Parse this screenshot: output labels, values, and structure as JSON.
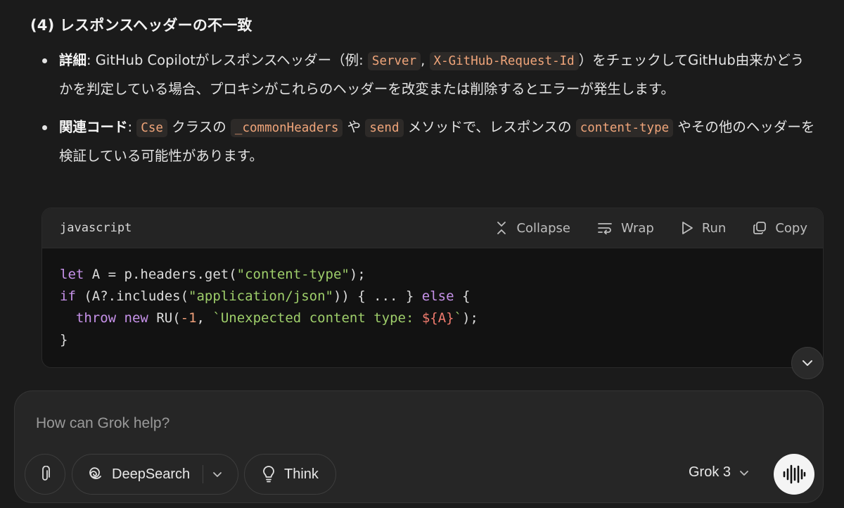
{
  "section": {
    "heading": "(4) レスポンスヘッダーの不一致"
  },
  "bullets": [
    {
      "label": "詳細",
      "text1": ": GitHub Copilotがレスポンスヘッダー（例: ",
      "code1": "Server",
      "text2": ", ",
      "code2": "X-GitHub-Request-Id",
      "text3": "）をチェックしてGitHub由来かどうかを判定している場合、プロキシがこれらのヘッダーを改変または削除するとエラーが発生します。"
    },
    {
      "label": "関連コード",
      "text1": ": ",
      "code1": "Cse",
      "text2": " クラスの ",
      "code2": "_commonHeaders",
      "text3": " や ",
      "code3": "send",
      "text4": " メソッドで、レスポンスの ",
      "code4": "content-type",
      "text5": " やその他のヘッダーを検証している可能性があります。"
    }
  ],
  "code_block": {
    "language": "javascript",
    "actions": {
      "collapse": "Collapse",
      "wrap": "Wrap",
      "run": "Run",
      "copy": "Copy"
    },
    "lines": {
      "l1_kw": "let",
      "l1_a": " A = p.headers.get(",
      "l1_str": "\"content-type\"",
      "l1_b": ");",
      "l2_kw": "if",
      "l2_a": " (A?.includes(",
      "l2_str": "\"application/json\"",
      "l2_b": ")) { ... } ",
      "l2_kw2": "else",
      "l2_c": " {",
      "l3_indent": "  ",
      "l3_kw": "throw",
      "l3_sp": " ",
      "l3_kw2": "new",
      "l3_a": " RU(",
      "l3_num": "-1",
      "l3_b": ", ",
      "l3_str": "`Unexpected content type: ",
      "l3_tmpl": "${A}",
      "l3_str2": "`",
      "l3_c": ");",
      "l4": "}"
    }
  },
  "composer": {
    "placeholder": "How can Grok help?",
    "deepsearch_label": "DeepSearch",
    "think_label": "Think",
    "model_label": "Grok 3"
  },
  "icons": {
    "attach": "paperclip-icon",
    "deepsearch": "swirl-icon",
    "think": "lightbulb-icon",
    "voice": "voice-waveform-icon",
    "collapse": "collapse-icon",
    "wrap": "wrap-icon",
    "run": "play-icon",
    "copy": "copy-icon",
    "scroll": "chevron-down-icon"
  },
  "colors": {
    "background": "#1b1b1b",
    "inline_code": "#f0a57a",
    "keyword": "#c792ea",
    "string": "#9ece6a",
    "number": "#f0a07a"
  }
}
